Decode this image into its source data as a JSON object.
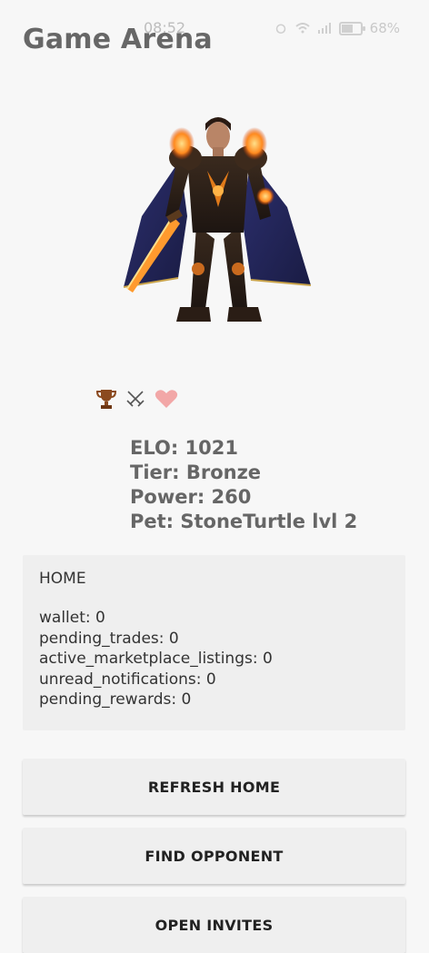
{
  "status_bar": {
    "time": "08:52",
    "battery": "68%",
    "battery_level": 0.68
  },
  "app": {
    "title": "Game Arena"
  },
  "hero": {
    "image_alt": "hero-character"
  },
  "badges": {
    "icons": [
      "trophy-icon",
      "crossed-swords-icon",
      "heart-icon"
    ],
    "colors": {
      "trophy": "#8b4a1f",
      "heart": "#f2a7a7",
      "swords": "#555555"
    }
  },
  "stats": {
    "elo": "ELO: 1021",
    "tier": "Tier: Bronze",
    "power": "Power: 260",
    "pet": "Pet: StoneTurtle lvl 2"
  },
  "home": {
    "heading": "HOME",
    "lines": [
      "wallet: 0",
      "pending_trades: 0",
      "active_marketplace_listings: 0",
      "unread_notifications: 0",
      "pending_rewards: 0"
    ]
  },
  "buttons": {
    "refresh_home": "REFRESH HOME",
    "find_opponent": "FIND OPPONENT",
    "open_invites": "OPEN INVITES"
  }
}
